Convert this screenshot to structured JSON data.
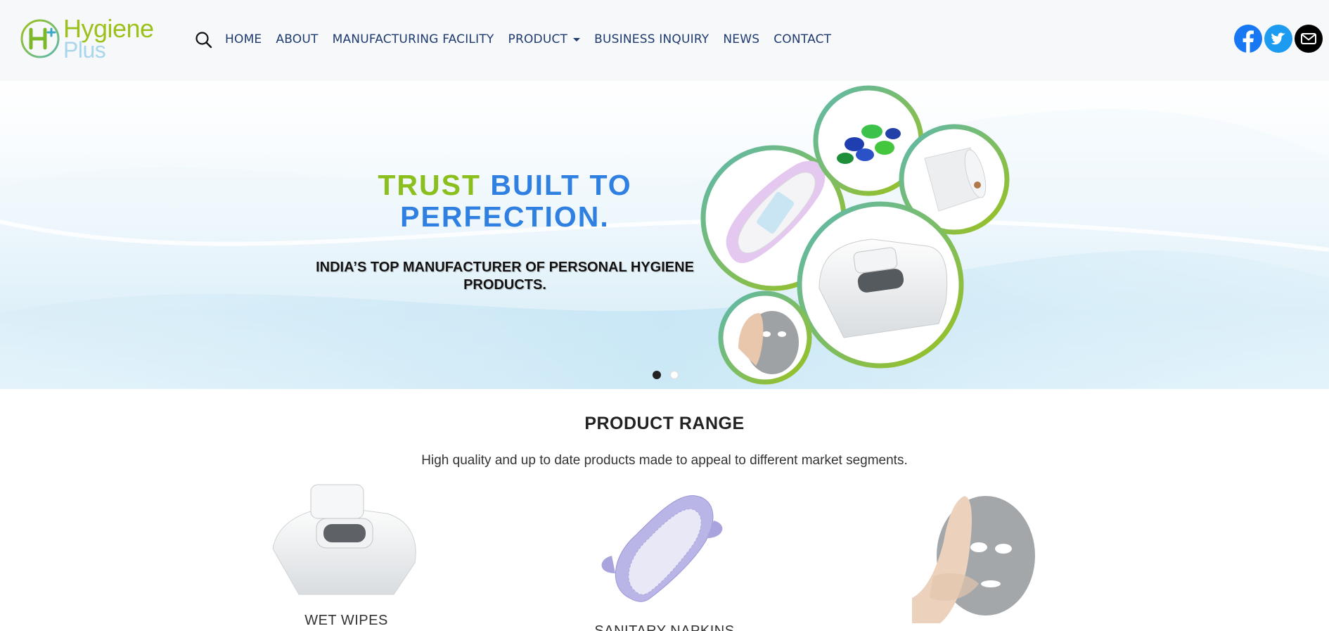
{
  "brand": {
    "line1": "Hygiene",
    "line2": "Plus"
  },
  "nav": {
    "items": [
      {
        "label": "HOME"
      },
      {
        "label": "ABOUT"
      },
      {
        "label": "MANUFACTURING FACILITY"
      },
      {
        "label": "PRODUCT"
      },
      {
        "label": "BUSINESS INQUIRY"
      },
      {
        "label": "NEWS"
      },
      {
        "label": "CONTACT"
      }
    ]
  },
  "social": [
    {
      "icon": "facebook-icon",
      "color": "#1877f2"
    },
    {
      "icon": "twitter-icon",
      "color": "#1d9bf0"
    },
    {
      "icon": "email-icon",
      "color": "#000000"
    }
  ],
  "hero": {
    "title_green": "TRUST",
    "title_blue_1": "BUILT TO",
    "title_blue_2": "PERFECTION.",
    "subtitle": "INDIA’S TOP MANUFACTURER OF PERSONAL HYGIENE PRODUCTS.",
    "slides_total": 2,
    "active_slide": 1
  },
  "products_section": {
    "title": "PRODUCT RANGE",
    "description": "High quality and up to date products made to appeal to different market segments.",
    "items": [
      {
        "name": "WET WIPES"
      },
      {
        "name": "SANITARY NAPKINS"
      },
      {
        "name": ""
      }
    ]
  },
  "colors": {
    "brand_green": "#9cc11b",
    "brand_blue": "#2f80e0",
    "nav_text": "#1f3a6e",
    "header_bg": "#f6f8fa"
  }
}
